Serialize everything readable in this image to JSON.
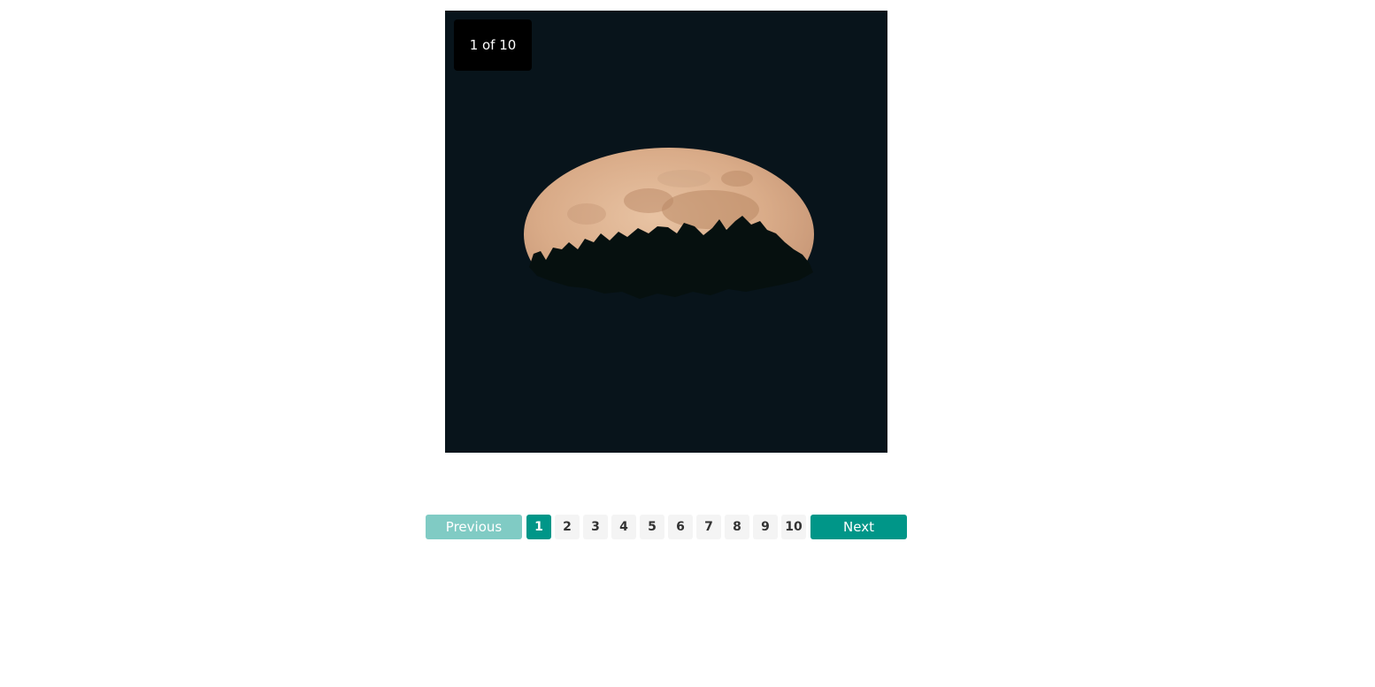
{
  "slideshow": {
    "counter": "1 of 10",
    "image_alt": "full moon rising behind tree silhouettes at night"
  },
  "pagination": {
    "previous_label": "Previous",
    "next_label": "Next",
    "pages": [
      "1",
      "2",
      "3",
      "4",
      "5",
      "6",
      "7",
      "8",
      "9",
      "10"
    ],
    "active_page": "1",
    "previous_disabled": true
  },
  "colors": {
    "accent": "#009688",
    "accent_disabled": "#80cbc4",
    "page_bg": "#f4f4f4",
    "slide_bg": "#08141b"
  }
}
